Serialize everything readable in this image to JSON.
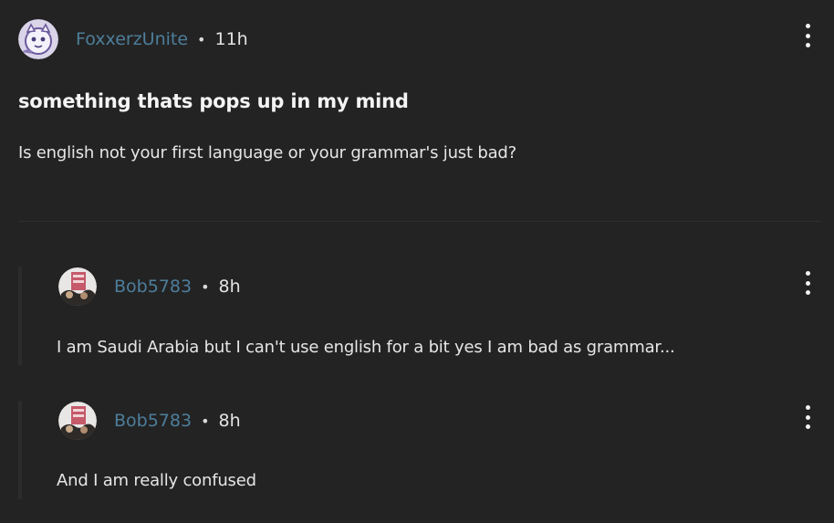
{
  "post": {
    "author": "FoxxerzUnite",
    "separator": "•",
    "time": "11h",
    "title": "something thats pops up in my mind",
    "body": "Is english not your first language or your grammar's just bad?"
  },
  "replies": [
    {
      "author": "Bob5783",
      "separator": "•",
      "time": "8h",
      "body": "I am Saudi Arabia but I can't use english for a bit yes I am bad as grammar..."
    },
    {
      "author": "Bob5783",
      "separator": "•",
      "time": "8h",
      "body": "And I am really confused"
    }
  ],
  "colors": {
    "background": "#232323",
    "username": "#4d7e9b",
    "text": "#e6e6e6"
  },
  "icons": {
    "more": "more-vertical-icon"
  }
}
